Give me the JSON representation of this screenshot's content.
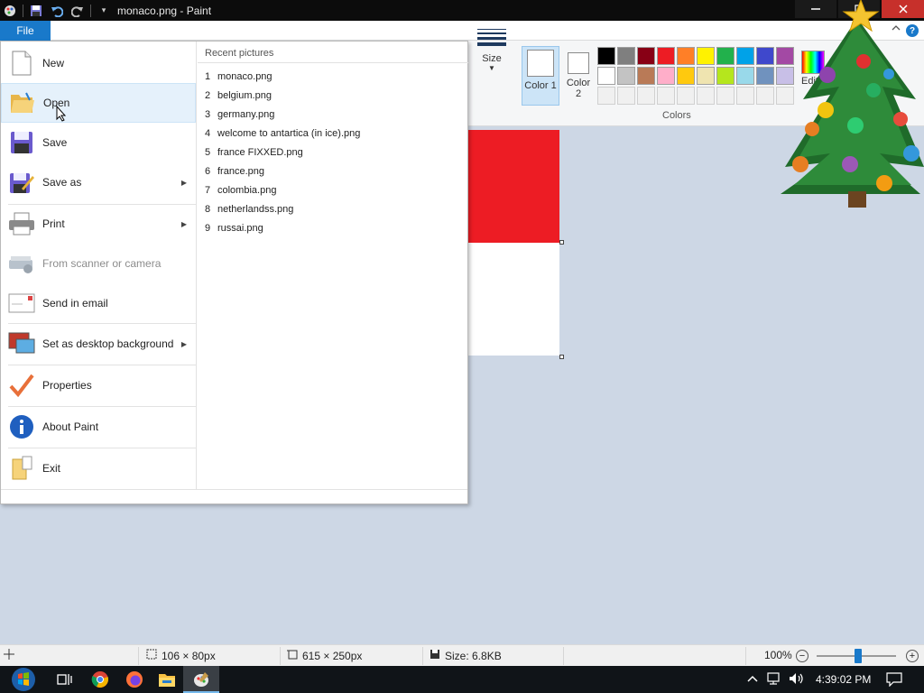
{
  "window": {
    "title": "monaco.png - Paint"
  },
  "ribbon": {
    "file_tab": "File",
    "size_label": "Size",
    "color1_label": "Color 1",
    "color2_label": "Color 2",
    "edit_colors_label": "Edit colors",
    "colors_group_label": "Colors",
    "help_label": "?"
  },
  "palette": {
    "row1": [
      "#000000",
      "#7f7f7f",
      "#880015",
      "#ed1c24",
      "#ff7f27",
      "#fff200",
      "#22b14c",
      "#00a2e8",
      "#3f48cc",
      "#a349a4"
    ],
    "row2": [
      "#ffffff",
      "#c3c3c3",
      "#b97a57",
      "#ffaec9",
      "#ffc90e",
      "#efe4b0",
      "#b5e61d",
      "#99d9ea",
      "#7092be",
      "#c8bfe7"
    ],
    "row3_empty_count": 10
  },
  "file_menu": {
    "items": [
      {
        "label": "New"
      },
      {
        "label": "Open"
      },
      {
        "label": "Save"
      },
      {
        "label": "Save as"
      },
      {
        "label": "Print"
      },
      {
        "label": "From scanner or camera"
      },
      {
        "label": "Send in email"
      },
      {
        "label": "Set as desktop background"
      },
      {
        "label": "Properties"
      },
      {
        "label": "About Paint"
      },
      {
        "label": "Exit"
      }
    ],
    "recent_title": "Recent pictures",
    "recent": [
      {
        "num": "1",
        "name": "monaco.png"
      },
      {
        "num": "2",
        "name": "belgium.png"
      },
      {
        "num": "3",
        "name": "germany.png"
      },
      {
        "num": "4",
        "name": "welcome to antartica (in ice).png"
      },
      {
        "num": "5",
        "name": "france FIXXED.png"
      },
      {
        "num": "6",
        "name": "france.png"
      },
      {
        "num": "7",
        "name": "colombia.png"
      },
      {
        "num": "8",
        "name": "netherlandss.png"
      },
      {
        "num": "9",
        "name": "russai.png"
      }
    ]
  },
  "canvas": {
    "top_color": "#ed1c24",
    "bottom_color": "#ffffff"
  },
  "statusbar": {
    "selection_size": "106 × 80px",
    "image_size": "615 × 250px",
    "file_size": "Size: 6.8KB",
    "zoom": "100%",
    "zoom_minus": "−",
    "zoom_plus": "+"
  },
  "taskbar": {
    "time": "4:39:02 PM"
  }
}
